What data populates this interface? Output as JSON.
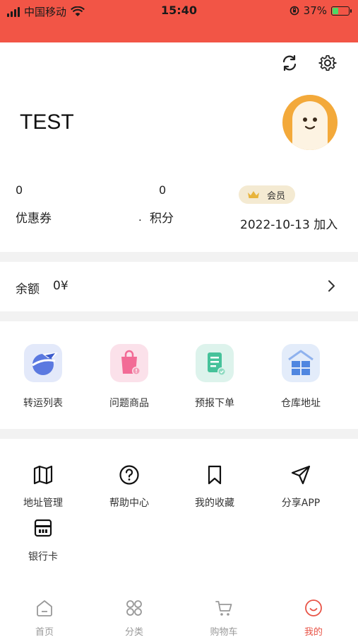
{
  "status_bar": {
    "carrier": "中国移动",
    "time": "15:40",
    "battery": "37%"
  },
  "profile": {
    "username": "TEST",
    "coupons": {
      "value": "0",
      "label": "优惠券"
    },
    "points": {
      "value": "0",
      "label": "积分"
    },
    "dot": ".",
    "member_badge": "会员",
    "join_date": "2022-10-13 加入"
  },
  "balance": {
    "label": "余额",
    "value": "0¥"
  },
  "quick_actions": [
    {
      "label": "转运列表",
      "icon": "plane-globe-icon"
    },
    {
      "label": "问题商品",
      "icon": "problem-bag-icon"
    },
    {
      "label": "预报下单",
      "icon": "forecast-doc-icon"
    },
    {
      "label": "仓库地址",
      "icon": "warehouse-icon"
    }
  ],
  "services": [
    {
      "label": "地址管理",
      "icon": "map-icon"
    },
    {
      "label": "帮助中心",
      "icon": "help-icon"
    },
    {
      "label": "我的收藏",
      "icon": "bookmark-icon"
    },
    {
      "label": "分享APP",
      "icon": "send-icon"
    },
    {
      "label": "银行卡",
      "icon": "bank-card-icon"
    }
  ],
  "tabbar": [
    {
      "label": "首页",
      "icon": "home-icon"
    },
    {
      "label": "分类",
      "icon": "category-icon"
    },
    {
      "label": "购物车",
      "icon": "cart-icon"
    },
    {
      "label": "我的",
      "icon": "smile-icon"
    }
  ],
  "colors": {
    "status_bar": "#f25546",
    "accent": "#e85346",
    "avatar": "#f3a93a",
    "badge_bg": "#f4ead2"
  }
}
